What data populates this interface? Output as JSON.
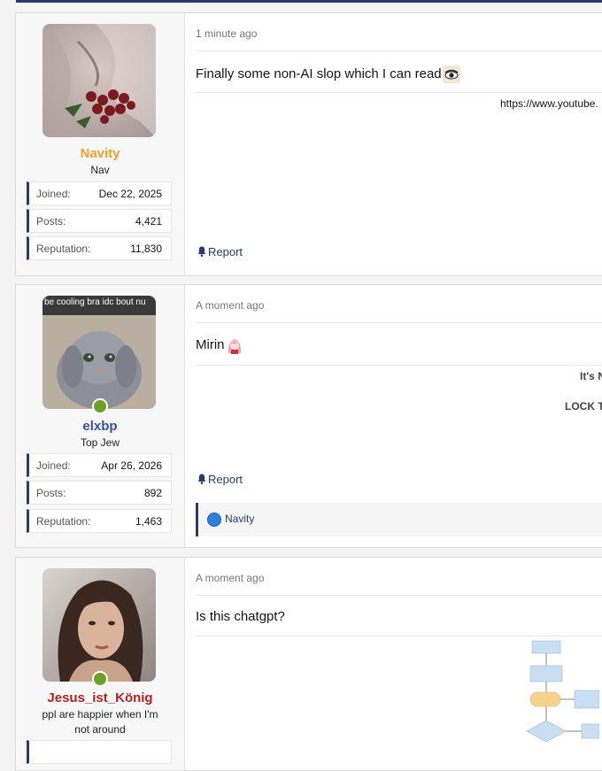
{
  "posts": [
    {
      "time": "1 minute ago",
      "username": "Navity",
      "username_color": "#f0a030",
      "user_title": "Nav",
      "online": false,
      "stats": [
        {
          "label": "Joined:",
          "value": "Dec 22, 2025"
        },
        {
          "label": "Posts:",
          "value": "4,421"
        },
        {
          "label": "Reputation:",
          "value": "11,830"
        }
      ],
      "message": "Finally some non-AI slop which I can read",
      "emoji": "eye-emoji",
      "signature": "https://www.youtube.",
      "report_label": "Report"
    },
    {
      "time": "A moment ago",
      "username": "elxbp",
      "username_color": "#3a4ea0",
      "user_title": "Top Jew",
      "avatar_caption": "be cooling bra idc bout nu",
      "online": true,
      "stats": [
        {
          "label": "Joined:",
          "value": "Apr 26, 2026"
        },
        {
          "label": "Posts:",
          "value": "892"
        },
        {
          "label": "Reputation:",
          "value": "1,463"
        }
      ],
      "message": "Mirin",
      "emoji": "anime-girl-emoji",
      "signature_lines": [
        "It's N",
        "LOCK TI"
      ],
      "report_label": "Report",
      "reactions": [
        "Navity"
      ]
    },
    {
      "time": "A moment ago",
      "username": "Jesus_ist_König",
      "username_color": "#b02222",
      "user_title": "ppl are happier when I'm not around",
      "online": true,
      "message": "Is this chatgpt?",
      "embedded_image": "flowchart-image"
    }
  ]
}
